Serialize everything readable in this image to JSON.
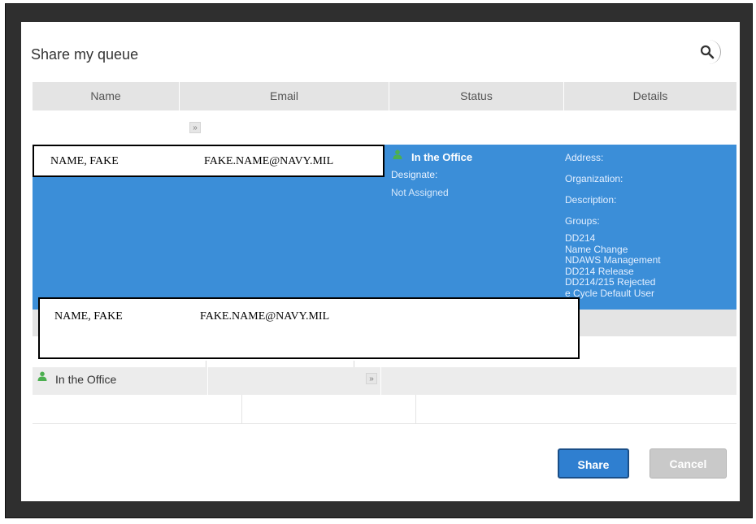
{
  "dialog": {
    "title": "Share my queue"
  },
  "search": {
    "value": "",
    "placeholder": ""
  },
  "table": {
    "headers": [
      "Name",
      "Email",
      "Status",
      "Details"
    ]
  },
  "selected_row": {
    "name": "NAME, FAKE",
    "email": "FAKE.NAME@NAVY.MIL",
    "status": "In the Office",
    "designate_label": "Designate:",
    "designate_value": "Not Assigned",
    "details": {
      "address_label": "Address:",
      "organization_label": "Organization:",
      "description_label": "Description:",
      "groups_label": "Groups:",
      "groups": [
        "DD214",
        "Name Change",
        "NDAWS Management",
        "DD214 Release",
        "DD214/215 Rejected",
        "e Cycle Default User"
      ]
    }
  },
  "second_row": {
    "name": "NAME, FAKE",
    "email": "FAKE.NAME@NAVY.MIL",
    "status": "In the Office"
  },
  "buttons": {
    "share": "Share",
    "cancel": "Cancel"
  },
  "colors": {
    "selection": "#3b8ed8",
    "share_button": "#2f7fd0",
    "cancel_button": "#c9c9c9",
    "status_green": "#4caf50"
  },
  "icons": {
    "search": "search-icon",
    "expand": "chevron-double-down-icon",
    "status": "person-icon"
  }
}
